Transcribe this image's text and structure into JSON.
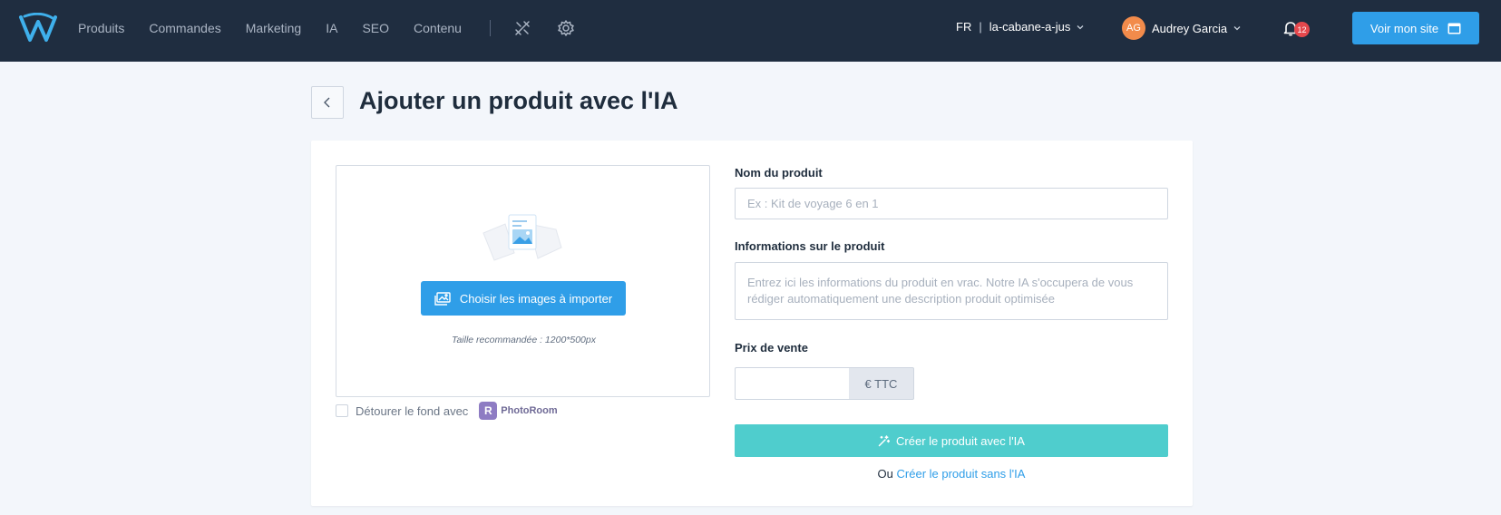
{
  "colors": {
    "navbar_bg": "#1f2d40",
    "primary": "#2f9ee8",
    "teal": "#4fcdcd",
    "avatar": "#f28b4b",
    "badge": "#e5484d"
  },
  "navbar": {
    "logo_icon": "brand-w-logo",
    "links": [
      "Produits",
      "Commandes",
      "Marketing",
      "IA",
      "SEO",
      "Contenu"
    ],
    "tools_icon": "tools-icon",
    "settings_icon": "gear-icon",
    "lang": "FR",
    "lang_sep": "|",
    "shop": "la-cabane-a-jus",
    "user_initials": "AG",
    "user_name": "Audrey Garcia",
    "notifications": "12",
    "site_button": "Voir mon site"
  },
  "page": {
    "title": "Ajouter un produit avec l'IA"
  },
  "upload": {
    "button": "Choisir les images à importer",
    "hint": "Taille recommandée : 1200*500px",
    "remove_bg_label": "Détourer le fond avec",
    "photoroom_mark": "R",
    "photoroom_text": "PhotoRoom"
  },
  "form": {
    "name_label": "Nom du produit",
    "name_placeholder": "Ex : Kit de voyage 6 en 1",
    "info_label": "Informations sur le produit",
    "info_placeholder": "Entrez ici les informations du produit en vrac. Notre IA s'occupera de vous rédiger automatiquement une description produit optimisée",
    "price_label": "Prix de vente",
    "price_value": "",
    "price_addon": "€ TTC",
    "create_ai_button": "Créer le produit avec l'IA",
    "or_text": "Ou",
    "create_manual_link": "Créer le produit sans l'IA"
  }
}
